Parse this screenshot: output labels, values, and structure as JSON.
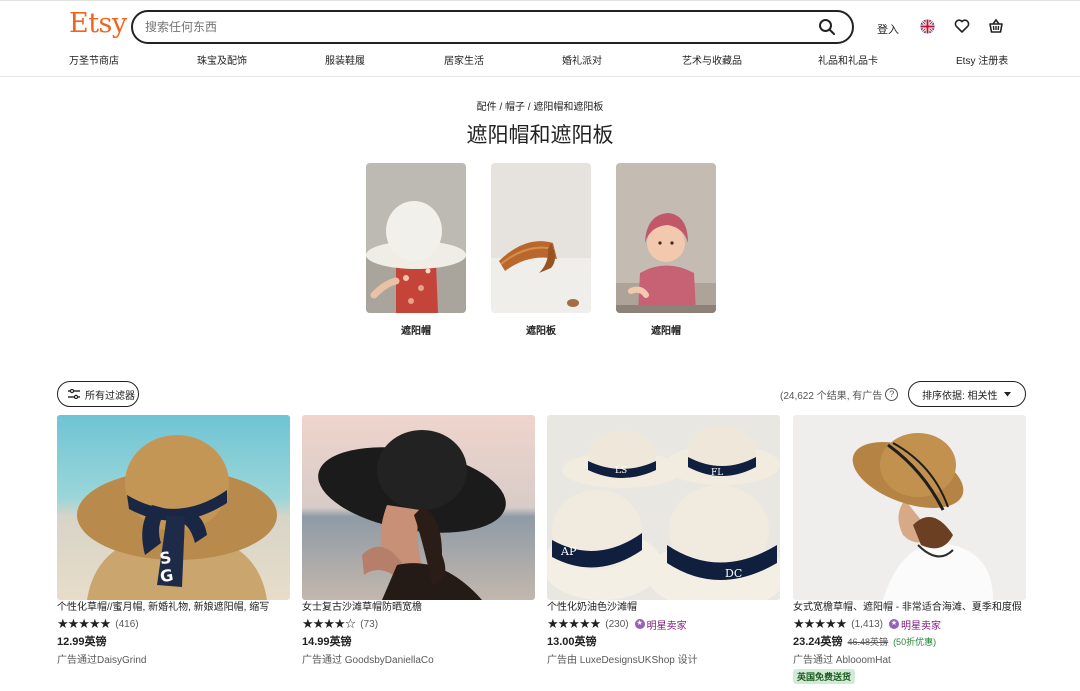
{
  "brand": {
    "logo": "Etsy",
    "color": "#f1641e"
  },
  "search": {
    "placeholder": "搜索任何东西",
    "icon": "search-icon"
  },
  "header": {
    "signin": "登入",
    "flag_icon": "uk-flag-icon",
    "favorites_icon": "heart-icon",
    "cart_icon": "cart-icon"
  },
  "nav": [
    "万圣节商店",
    "珠宝及配饰",
    "服装鞋履",
    "居家生活",
    "婚礼派对",
    "艺术与收藏品",
    "礼品和礼品卡",
    "Etsy 注册表"
  ],
  "breadcrumb": {
    "items": [
      "配件",
      "帽子",
      "遮阳帽和遮阳板"
    ],
    "sep": "/"
  },
  "page_title": "遮阳帽和遮阳板",
  "categories": [
    {
      "label": "遮阳帽"
    },
    {
      "label": "遮阳板"
    },
    {
      "label": "遮阳帽"
    }
  ],
  "toolbar": {
    "filters_label": "所有过滤器",
    "results_text": "(24,622 个结果,  有广告",
    "help_icon": "?",
    "sort_label": "排序依据: 相关性"
  },
  "listings": [
    {
      "title": "个性化草帽//蜜月帽, 新婚礼物, 新娘遮阳帽, 缩写",
      "stars": "★★★★★",
      "rating_count": "(416)",
      "star_seller": "",
      "price": "12.99英镑",
      "old_price": "",
      "discount": "",
      "ad": "广告通过DaisyGrind",
      "badge": ""
    },
    {
      "title": "女士复古沙滩草帽防晒宽檐",
      "stars": "★★★★☆",
      "rating_count": "(73)",
      "star_seller": "",
      "price": "14.99英镑",
      "old_price": "",
      "discount": "",
      "ad": "广告通过 GoodsbyDaniellaCo",
      "badge": ""
    },
    {
      "title": "个性化奶油色沙滩帽",
      "stars": "★★★★★",
      "rating_count": "(230)",
      "star_seller": "明星卖家",
      "price": "13.00英镑",
      "old_price": "",
      "discount": "",
      "ad": "广告由 LuxeDesignsUKShop 设计",
      "badge": ""
    },
    {
      "title": "女式宽檐草帽、遮阳帽 - 非常适合海滩、夏季和度假",
      "stars": "★★★★★",
      "rating_count": "(1,413)",
      "star_seller": "明星卖家",
      "price": "23.24英镑",
      "old_price": "46.48英镑",
      "discount": "(50折优惠)",
      "ad": "广告通过 AblooomHat",
      "badge": "英国免费送货"
    }
  ]
}
